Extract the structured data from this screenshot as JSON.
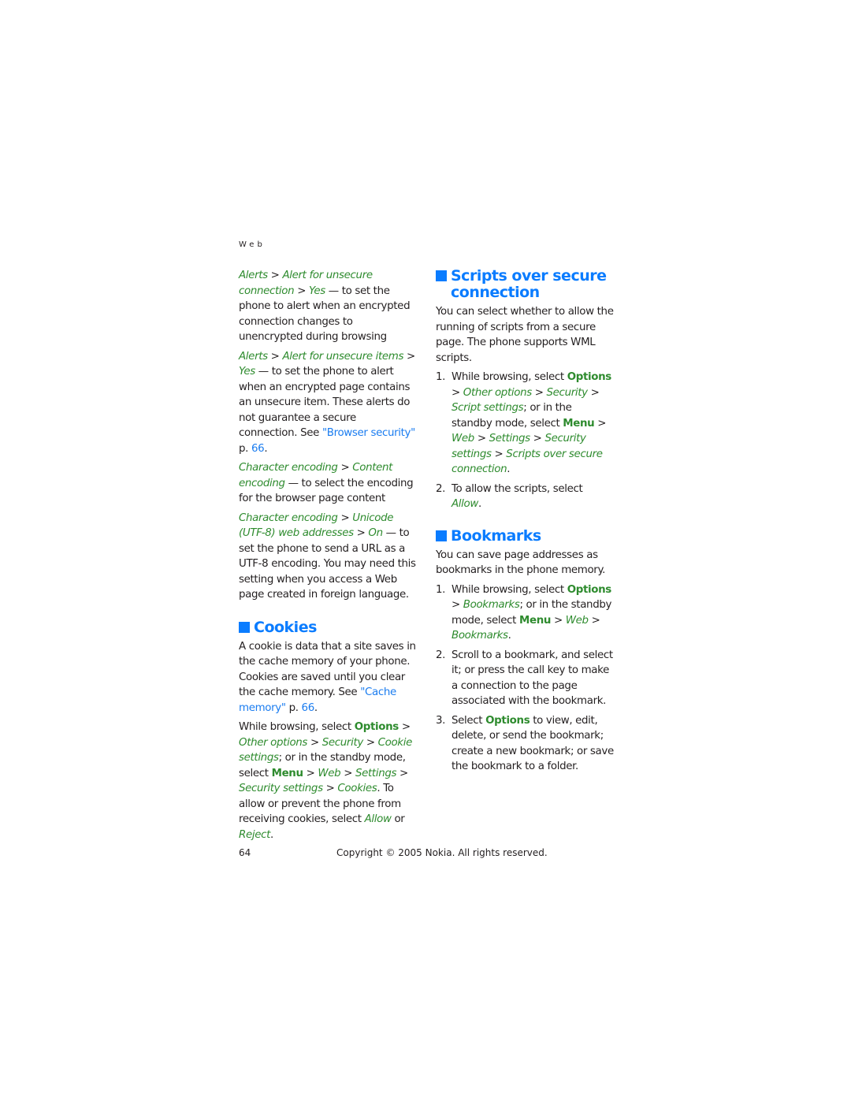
{
  "header": {
    "section": "Web"
  },
  "left": {
    "alerts1": {
      "p1": "Alerts",
      "p2": "Alert for unsecure connection",
      "p3": "Yes",
      "desc": " — to set the phone to alert when an encrypted connection changes to unencrypted during browsing"
    },
    "alerts2": {
      "p1": "Alerts",
      "p2": "Alert for unsecure items",
      "p3": "Yes",
      "desc": " — to set the phone to alert when an encrypted page contains an unsecure item. These alerts do not guarantee a secure connection. See ",
      "link": "\"Browser security\"",
      "page_prefix": " p. ",
      "page": "66",
      "end": "."
    },
    "enc1": {
      "p1": "Character encoding",
      "p2": "Content encoding",
      "desc": " — to select the encoding for the browser page content"
    },
    "enc2": {
      "p1": "Character encoding",
      "p2": "Unicode (UTF-8) web addresses",
      "p3": "On",
      "desc": " — to set the phone to send a URL as a UTF-8 encoding. You may need this setting when you access a Web page created in foreign language."
    },
    "cookies": {
      "title": "Cookies",
      "intro": "A cookie is data that a site saves in the cache memory of your phone. Cookies are saved until you clear the cache memory. See ",
      "link": "\"Cache memory\"",
      "page_prefix": " p. ",
      "page": "66",
      "end": ".",
      "s1": "While browsing, select ",
      "options": "Options",
      "other_options": "Other options",
      "security": "Security",
      "cookie_settings": "Cookie settings",
      "s2": "; or in the standby mode, select ",
      "menu": "Menu",
      "web": "Web",
      "settings": "Settings",
      "security_settings": "Security settings",
      "cookies_item": "Cookies",
      "s3": ". To allow or prevent the phone from receiving cookies, select ",
      "allow": "Allow",
      "or": " or ",
      "reject": "Reject",
      "end2": "."
    }
  },
  "right": {
    "scripts": {
      "title": "Scripts over secure connection",
      "intro": "You can select whether to allow the running of scripts from a secure page. The phone supports WML scripts.",
      "steps": [
        {
          "num": "1.",
          "s1": "While browsing, select ",
          "options": "Options",
          "other_options": "Other options",
          "security": "Security",
          "script_settings": "Script settings",
          "s2": "; or in the standby mode, select ",
          "menu": "Menu",
          "web": "Web",
          "settings": "Settings",
          "security_settings": "Security settings",
          "item": "Scripts over secure connection",
          "end": "."
        },
        {
          "num": "2.",
          "text": "To allow the scripts, select ",
          "allow": "Allow",
          "end": "."
        }
      ]
    },
    "bookmarks": {
      "title": "Bookmarks",
      "intro": "You can save page addresses as bookmarks in the phone memory.",
      "steps": [
        {
          "num": "1.",
          "s1": "While browsing, select ",
          "options": "Options",
          "bookmarks": "Bookmarks",
          "s2": "; or in the standby mode, select ",
          "menu": "Menu",
          "web": "Web",
          "end": "."
        },
        {
          "num": "2.",
          "text": "Scroll to a bookmark, and select it; or press the call key to make a connection to the page associated with the bookmark."
        },
        {
          "num": "3.",
          "s1": "Select ",
          "options": "Options",
          "s2": " to view, edit, delete, or send the bookmark; create a new bookmark; or save the bookmark to a folder."
        }
      ]
    }
  },
  "footer": {
    "page_number": "64",
    "copyright": "Copyright © 2005 Nokia. All rights reserved."
  }
}
